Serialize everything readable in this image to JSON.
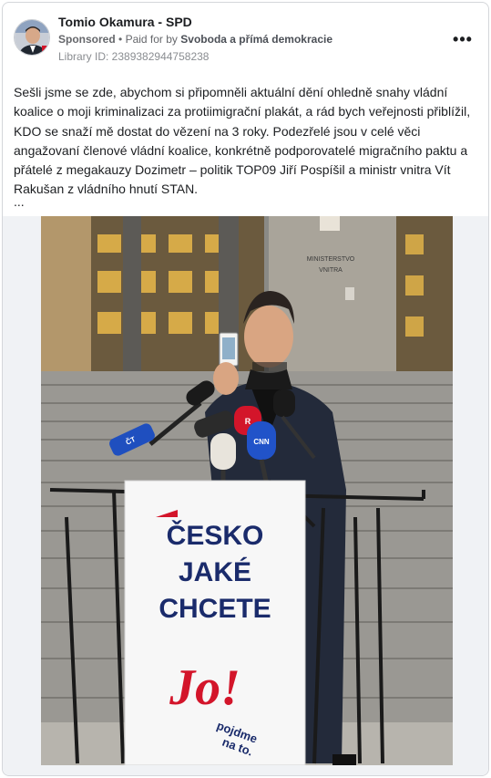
{
  "post": {
    "page_name": "Tomio Okamura - SPD",
    "sponsored": "Sponsored",
    "separator": "•",
    "paid_for_prefix": "Paid for by",
    "funder": "Svoboda a přímá demokracie",
    "library_id": "Library ID: 2389382944758238",
    "more_label": "•••",
    "body": "Sešli jsme se zde, abychom si připomněli aktuální dění ohledně snahy vládní koalice o moji kriminalizaci za protiimigrační plakát, a rád bych veřejnosti přiblížil, KDO se snaží mě dostat do vězení na 3 roky. Podezřelé jsou v celé věci angažovaní členové vládní koalice, konkrétně podporovatelé migračního paktu a přátelé z megakauzy Dozimetr – politik TOP09 Jiří Pospíšil a ministr vnitra Vít Rakušan z vládního hnutí STAN.",
    "ellipsis": "..."
  },
  "photo": {
    "building_sign_line1": "MINISTERSTVO",
    "building_sign_line2": "VNITRA",
    "sign_line1": "ČESKO",
    "sign_line2": "JAKÉ",
    "sign_line3": "CHCETE",
    "logo_text": "Jo!",
    "logo_sub1": "pojdme",
    "logo_sub2": "na to.",
    "mic_label_ct": "ČT",
    "mic_label_cnn": "CNN",
    "mic_label_r": "R"
  },
  "colors": {
    "accent_red": "#d3152a",
    "sign_navy": "#1a2b6b",
    "meta_gray": "#65676b"
  }
}
